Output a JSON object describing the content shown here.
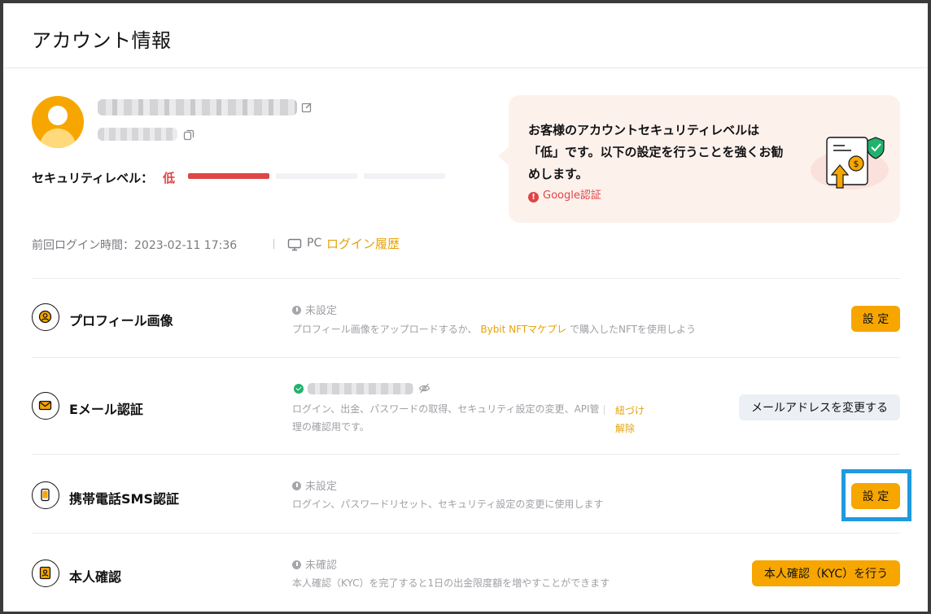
{
  "page": {
    "title": "アカウント情報"
  },
  "profile": {
    "security_label": "セキュリティレベル：",
    "security_value": "低",
    "security_level_filled": 1,
    "security_level_total": 3,
    "last_login_label": "前回ログイン時間：2023-02-11 17:36",
    "device": "PC",
    "login_history_link": "ログイン履歴"
  },
  "notice": {
    "text": "お客様のアカウントセキュリティレベルは「低」です。以下の設定を行うことを強くお勧めします。",
    "link": "Google認証"
  },
  "rows": [
    {
      "title": "プロフィール画像",
      "status": "未設定",
      "desc_before": "プロフィール画像をアップロードするか、",
      "desc_accent": "Bybit NFTマケプレ",
      "desc_after": "で購入したNFTを使用しよう",
      "button": "設 定"
    },
    {
      "title": "Eメール認証",
      "desc": "ログイン、出金、パスワードの取得、セキュリティ設定の変更、API管理の確認用です。",
      "unlink": "紐づけ解除",
      "button": "メールアドレスを変更する"
    },
    {
      "title": "携帯電話SMS認証",
      "status": "未設定",
      "desc": "ログイン、パスワードリセット、セキュリティ設定の変更に使用します",
      "button": "設 定"
    },
    {
      "title": "本人確認",
      "status": "未確認",
      "desc": "本人確認（KYC）を完了すると1日の出金限度額を増やすことができます",
      "button": "本人確認（KYC）を行う"
    }
  ],
  "colors": {
    "accent": "#f7a600",
    "danger": "#de4545",
    "link": "#e5a20a",
    "highlight": "#1e9ae0"
  }
}
